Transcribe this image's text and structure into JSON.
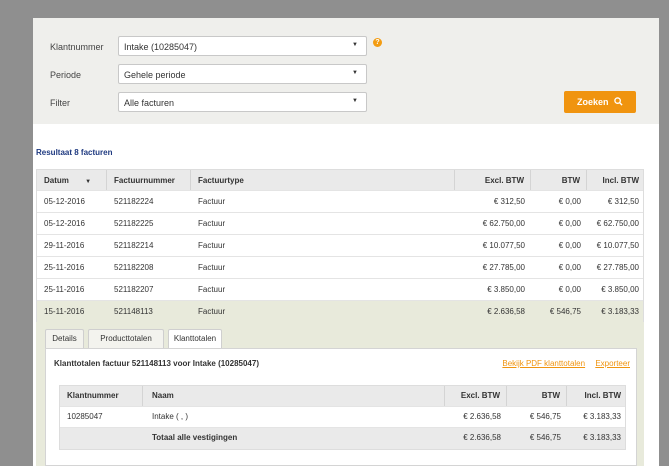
{
  "filters": {
    "klantnummer": {
      "label": "Klantnummer",
      "value": "Intake (10285047)"
    },
    "periode": {
      "label": "Periode",
      "value": "Gehele periode"
    },
    "filter": {
      "label": "Filter",
      "value": "Alle facturen"
    },
    "help": "?",
    "search_label": "Zoeken"
  },
  "result_label": "Resultaat 8 facturen",
  "table": {
    "headers": [
      "Datum",
      "Factuurnummer",
      "Factuurtype",
      "Excl. BTW",
      "BTW",
      "Incl. BTW"
    ],
    "rows": [
      [
        "05-12-2016",
        "521182224",
        "Factuur",
        "€ 312,50",
        "€ 0,00",
        "€ 312,50"
      ],
      [
        "05-12-2016",
        "521182225",
        "Factuur",
        "€ 62.750,00",
        "€ 0,00",
        "€ 62.750,00"
      ],
      [
        "29-11-2016",
        "521182214",
        "Factuur",
        "€ 10.077,50",
        "€ 0,00",
        "€ 10.077,50"
      ],
      [
        "25-11-2016",
        "521182208",
        "Factuur",
        "€ 27.785,00",
        "€ 0,00",
        "€ 27.785,00"
      ],
      [
        "25-11-2016",
        "521182207",
        "Factuur",
        "€ 3.850,00",
        "€ 0,00",
        "€ 3.850,00"
      ],
      [
        "15-11-2016",
        "521148113",
        "Factuur",
        "€ 2.636,58",
        "€ 546,75",
        "€ 3.183,33"
      ]
    ]
  },
  "detail": {
    "tabs": [
      "Details",
      "Producttotalen",
      "Klanttotalen"
    ],
    "active_tab": "Klanttotalen",
    "title": "Klanttotalen factuur 521148113 voor Intake (10285047)",
    "links": {
      "pdf": "Bekijk PDF klanttotalen",
      "export": "Exporteer"
    },
    "sub_headers": [
      "Klantnummer",
      "Naam",
      "Excl. BTW",
      "BTW",
      "Incl. BTW"
    ],
    "sub_row": [
      "10285047",
      "Intake ( , )",
      "€ 2.636,58",
      "€ 546,75",
      "€ 3.183,33"
    ],
    "total_row": {
      "label": "Totaal alle vestigingen",
      "excl": "€ 2.636,58",
      "btw": "€ 546,75",
      "incl": "€ 3.183,33"
    }
  },
  "colors": {
    "accent": "#f0940f",
    "link": "#1f3a80",
    "selected_row": "#e8eadb",
    "panel": "#efefec"
  }
}
